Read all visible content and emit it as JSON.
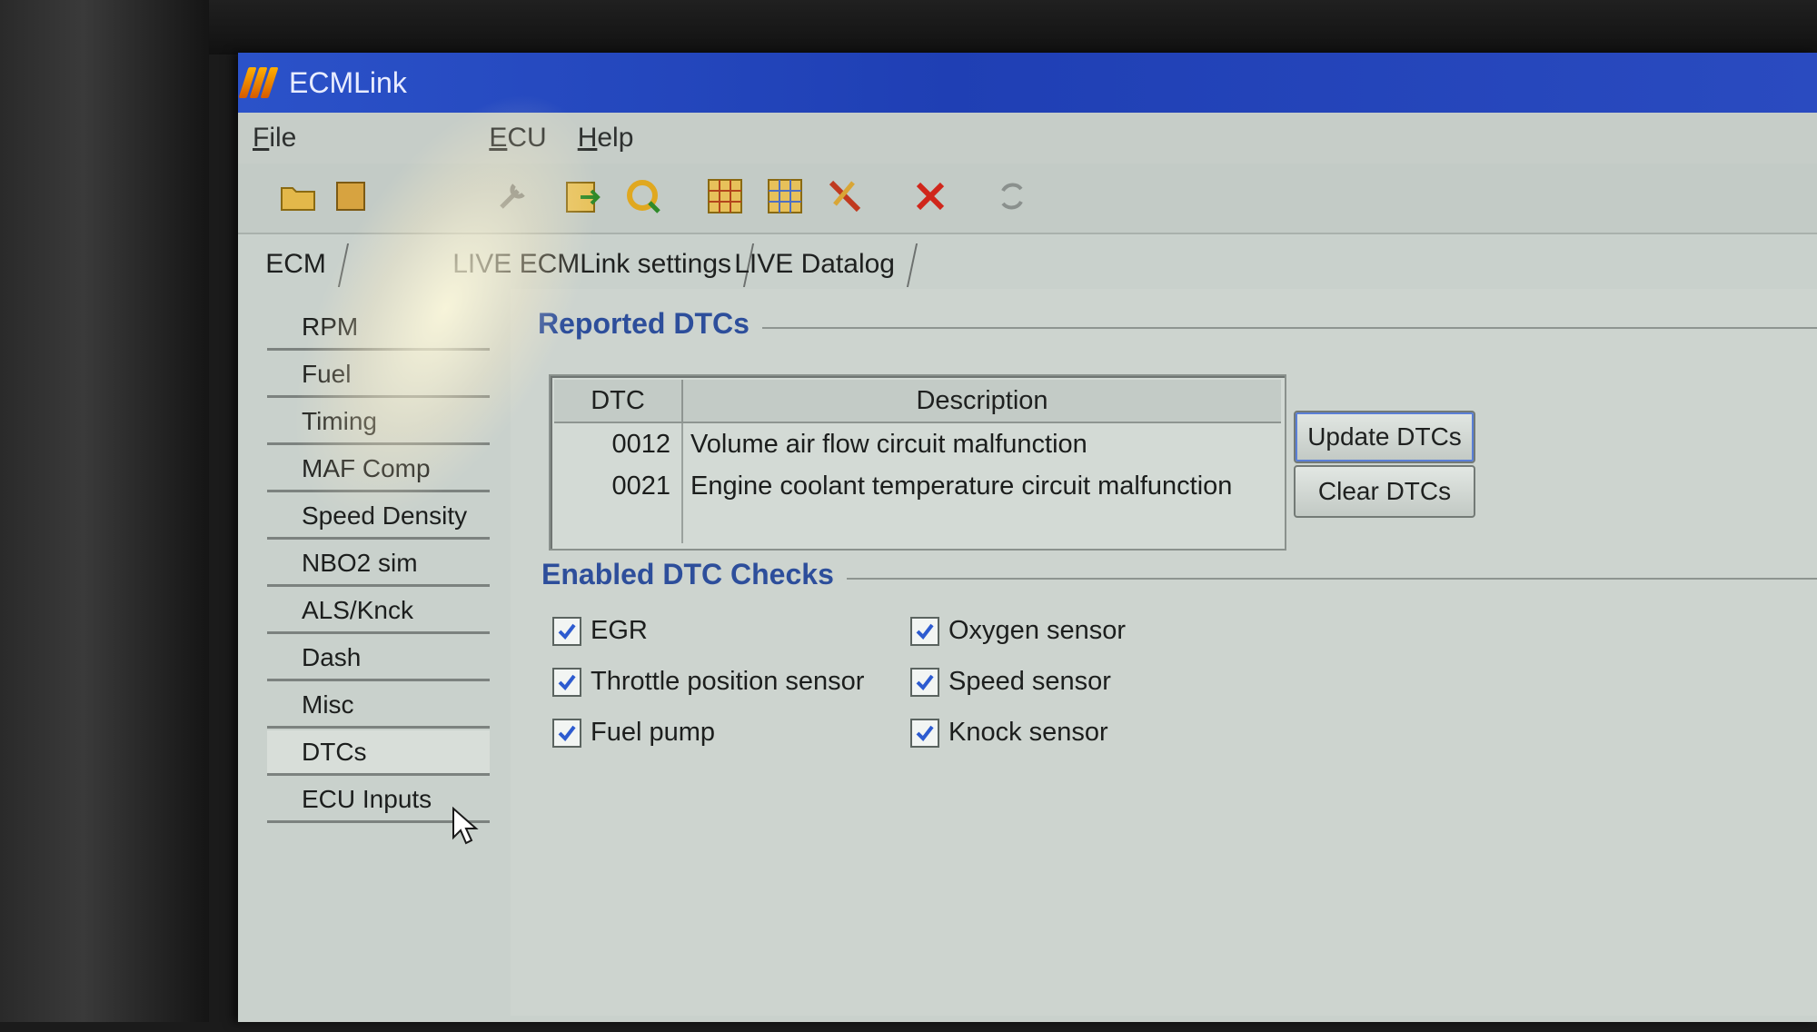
{
  "window": {
    "title": "ECMLink"
  },
  "menu": [
    "File",
    "ECU",
    "Help"
  ],
  "toolbar": {
    "icons": [
      "open-folder-icon",
      "save-icon",
      "tools-icon",
      "export-icon",
      "refresh-icon",
      "map-icon",
      "map-settings-icon",
      "wrench-icon",
      "delete-icon",
      "sync-icon"
    ]
  },
  "tabs": [
    "ECM",
    "LIVE ECMLink settings",
    "LIVE Datalog"
  ],
  "sidebar": {
    "items": [
      "RPM",
      "Fuel",
      "Timing",
      "MAF Comp",
      "Speed Density",
      "NBO2 sim",
      "ALS/Knck",
      "Dash",
      "Misc",
      "DTCs",
      "ECU Inputs"
    ]
  },
  "reported": {
    "title": "Reported DTCs",
    "columns": {
      "dtc": "DTC",
      "description": "Description"
    },
    "rows": [
      {
        "code": "0012",
        "text": "Volume air flow circuit malfunction"
      },
      {
        "code": "0021",
        "text": "Engine coolant temperature circuit malfunction"
      }
    ],
    "update_label": "Update DTCs",
    "clear_label": "Clear DTCs"
  },
  "enabled": {
    "title": "Enabled DTC Checks",
    "checks": [
      {
        "label": "EGR",
        "checked": true
      },
      {
        "label": "Throttle position sensor",
        "checked": true
      },
      {
        "label": "Fuel pump",
        "checked": true
      },
      {
        "label": "Oxygen sensor",
        "checked": true
      },
      {
        "label": "Speed sensor",
        "checked": true
      },
      {
        "label": "Knock sensor",
        "checked": true
      }
    ]
  },
  "colors": {
    "titlebar": "#2b52c9",
    "group_title": "#2d4e9b",
    "delete": "#d0261b"
  }
}
